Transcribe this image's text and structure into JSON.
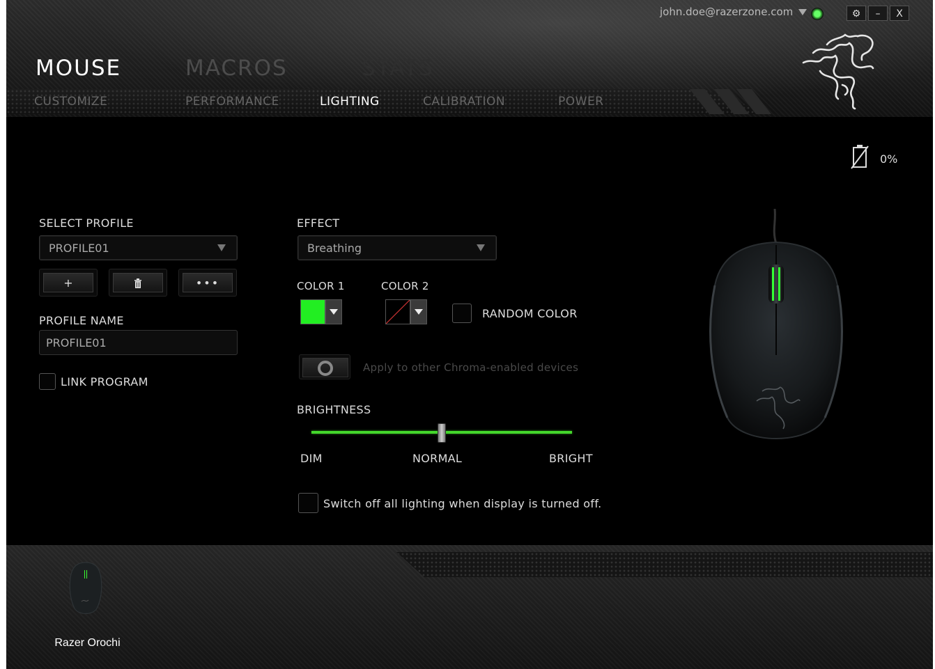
{
  "account": {
    "email": "john.doe@razerzone.com"
  },
  "window_controls": {
    "settings": "⚙",
    "minimize": "–",
    "close": "X"
  },
  "main_tabs": [
    {
      "label": "MOUSE",
      "active": true
    },
    {
      "label": "MACROS",
      "active": false
    },
    {
      "label": "STATS",
      "active": false
    }
  ],
  "sub_tabs": [
    {
      "label": "CUSTOMIZE",
      "active": false
    },
    {
      "label": "PERFORMANCE",
      "active": false
    },
    {
      "label": "LIGHTING",
      "active": true
    },
    {
      "label": "CALIBRATION",
      "active": false
    },
    {
      "label": "POWER",
      "active": false
    }
  ],
  "battery": {
    "percent": "0%"
  },
  "profile": {
    "select_label": "SELECT PROFILE",
    "selected": "PROFILE01",
    "add_button": "+",
    "delete_button": "🗑",
    "more_button": "•••",
    "name_label": "PROFILE NAME",
    "name_value": "PROFILE01",
    "link_program_label": "LINK PROGRAM"
  },
  "lighting": {
    "effect_label": "EFFECT",
    "effect_value": "Breathing",
    "color1_label": "COLOR 1",
    "color1": "#22ee22",
    "color2_label": "COLOR 2",
    "random_color_label": "RANDOM COLOR",
    "apply_label": "Apply to other Chroma-enabled devices",
    "brightness_label": "BRIGHTNESS",
    "brightness_value": 0.5,
    "dim_label": "DIM",
    "normal_label": "NORMAL",
    "bright_label": "BRIGHT",
    "switch_off_label": "Switch off all lighting when display is turned off."
  },
  "device": {
    "name": "Razer Orochi"
  },
  "colors": {
    "accent": "#44d62c",
    "background": "#000000"
  }
}
